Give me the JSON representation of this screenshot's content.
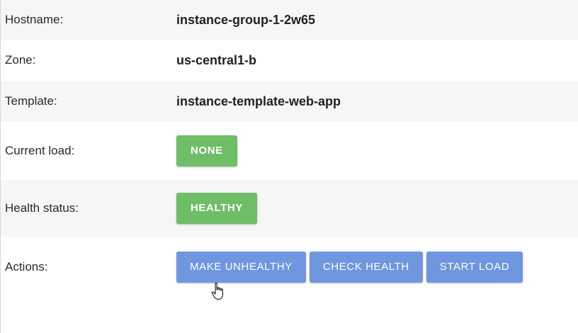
{
  "rows": {
    "hostname": {
      "label": "Hostname:",
      "value": "instance-group-1-2w65"
    },
    "zone": {
      "label": "Zone:",
      "value": "us-central1-b"
    },
    "template": {
      "label": "Template:",
      "value": "instance-template-web-app"
    },
    "current_load": {
      "label": "Current load:",
      "badge": "NONE"
    },
    "health_status": {
      "label": "Health status:",
      "badge": "HEALTHY"
    },
    "actions": {
      "label": "Actions:",
      "buttons": [
        "MAKE UNHEALTHY",
        "CHECK HEALTH",
        "START LOAD"
      ]
    }
  },
  "colors": {
    "badge_green": "#6fbd66",
    "button_blue": "#6f97e0",
    "row_alt_bg": "#f6f6f6"
  },
  "icons": {
    "cursor": "hand-pointer-icon"
  }
}
